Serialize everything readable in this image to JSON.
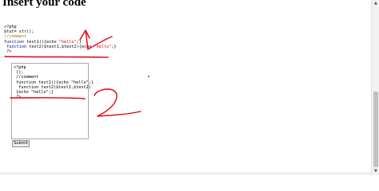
{
  "page": {
    "heading": "Insert your code",
    "submit_label": "Submit"
  },
  "output_code": {
    "lines": [
      {
        "parts": [
          {
            "t": "<?php",
            "c": "c-tag"
          }
        ]
      },
      {
        "parts": [
          {
            "t": "$tut= str();",
            "c": ""
          }
        ]
      },
      {
        "parts": [
          {
            "t": "//comment",
            "c": "c-comment"
          }
        ]
      },
      {
        "parts": [
          {
            "t": "function",
            "c": "c-kw"
          },
          {
            "t": " test1(){echo ",
            "c": ""
          },
          {
            "t": "\"hello\"",
            "c": "c-str"
          },
          {
            "t": ";}",
            "c": ""
          }
        ]
      },
      {
        "parts": [
          {
            "t": " function",
            "c": "c-kw"
          },
          {
            "t": " test2($test1,$test2){echo ",
            "c": ""
          },
          {
            "t": "\"hello\"",
            "c": "c-str"
          },
          {
            "t": ";}",
            "c": ""
          }
        ]
      },
      {
        "parts": [
          {
            "t": " ?>",
            "c": "c-tag"
          }
        ]
      }
    ]
  },
  "editor": {
    "lines": [
      "<?php",
      " ();",
      " //comment",
      " function test1(){echo \"hello\";}",
      "  function test2($test1,$test2)",
      " {echo \"hello\";}",
      " ?>"
    ]
  },
  "annotations": {
    "label_1": "1",
    "label_2": "2",
    "ink_color": "#e8000b"
  }
}
